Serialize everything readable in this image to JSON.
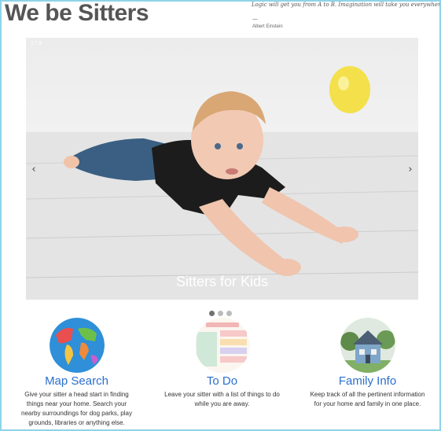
{
  "header": {
    "title": "We be Sitters",
    "quote": "Logic will get you from A to B. Imagination will take you everywhere.",
    "quote_dash": "—",
    "quote_author": "Albert Einstein"
  },
  "slideshow": {
    "counter": "1 / 3",
    "caption": "Sitters for Kids",
    "prev_glyph": "‹",
    "next_glyph": "›",
    "slide_count": 3,
    "active_slide": 1
  },
  "features": [
    {
      "title": "Map Search",
      "description": "Give your sitter a head start in finding things near your home. Search your nearby surroundings for dog parks, play grounds, libraries or anything else.",
      "icon": "world-map-icon"
    },
    {
      "title": "To Do",
      "description": "Leave your sitter with a list of things to do while you are away.",
      "icon": "todo-list-icon"
    },
    {
      "title": "Family Info",
      "description": "Keep track of all the pertinent information for your home and family in one place.",
      "icon": "house-icon"
    }
  ],
  "colors": {
    "frame": "#8fd3e8",
    "link": "#2a6fcf",
    "title": "#555555"
  }
}
